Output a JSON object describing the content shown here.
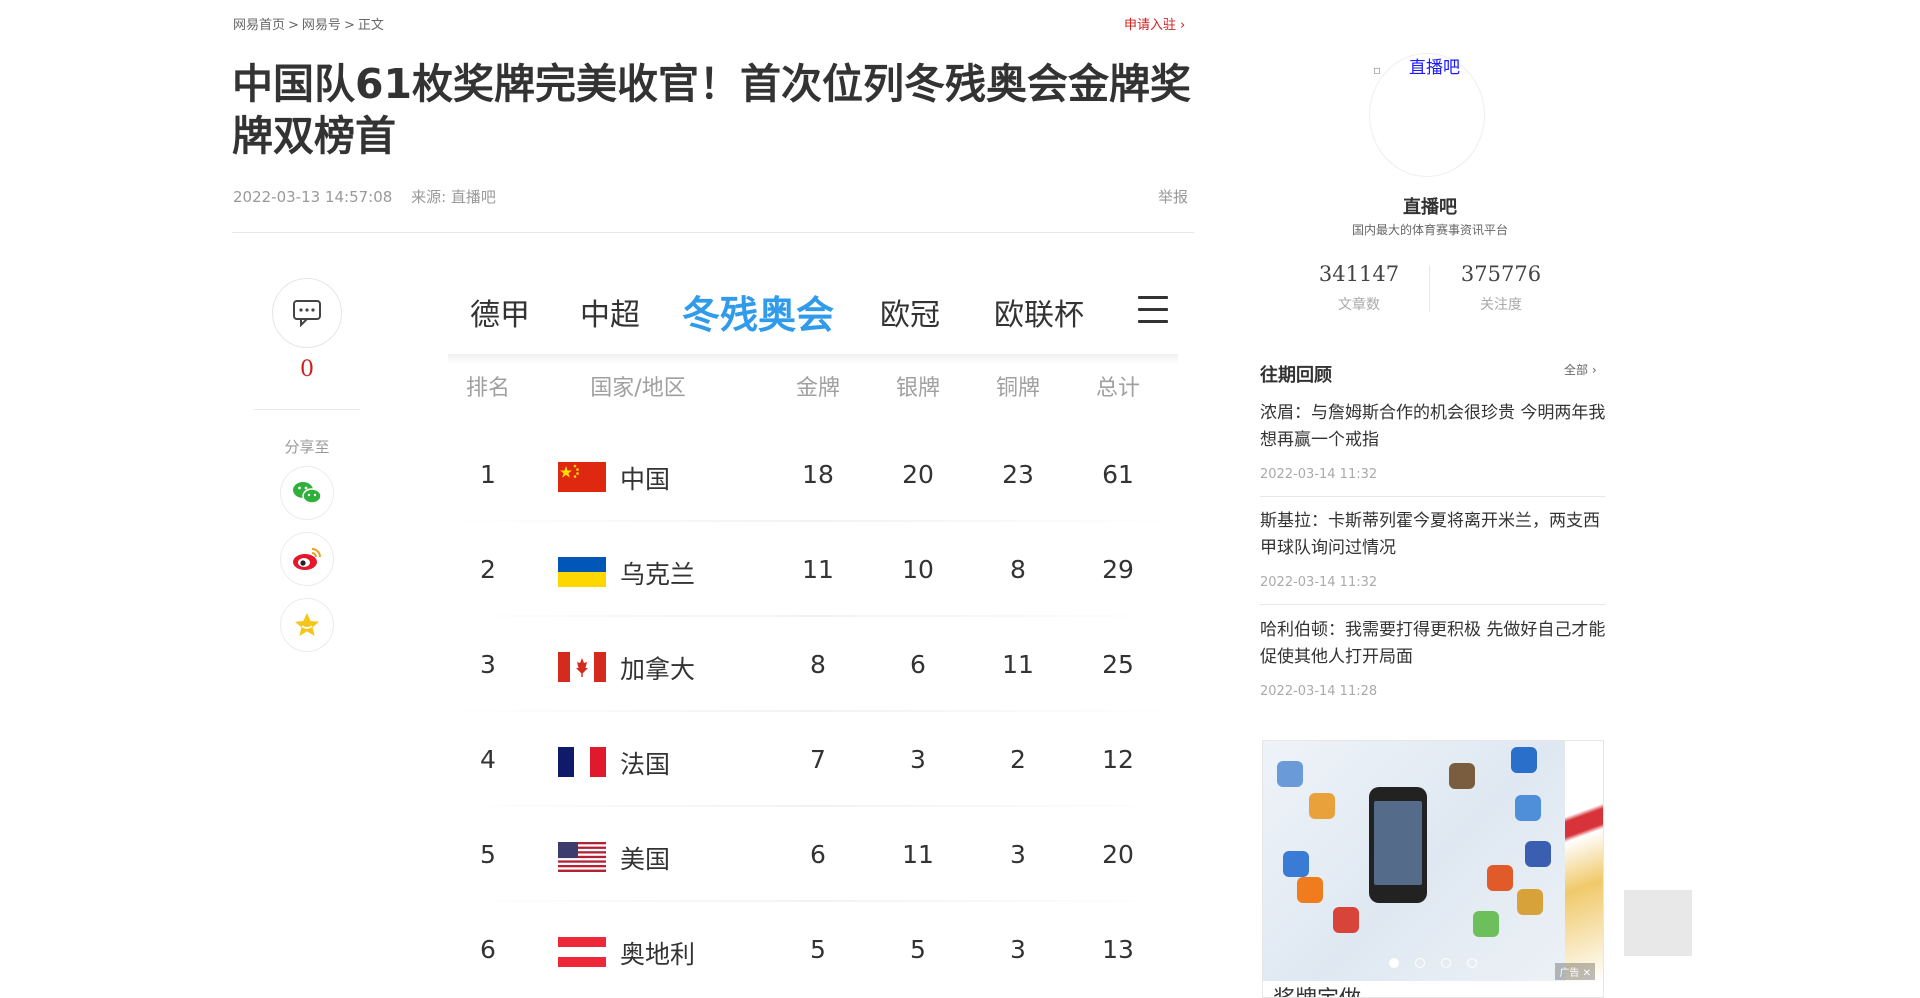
{
  "breadcrumb": {
    "home": "网易首页",
    "section": "网易号",
    "current": "正文",
    "sep": ">"
  },
  "apply": {
    "label": "申请入驻",
    "chev": "›"
  },
  "article": {
    "title": "中国队61枚奖牌完美收官！首次位列冬残奥会金牌奖牌双榜首",
    "datetime": "2022-03-13 14:57:08",
    "source": "来源: 直播吧",
    "report": "举报"
  },
  "social": {
    "comment_count": "0",
    "share_label": "分享至"
  },
  "medal_image": {
    "tabs": [
      "德甲",
      "中超",
      "冬残奥会",
      "欧冠",
      "欧联杯"
    ],
    "active_tab": "冬残奥会",
    "headers": {
      "rank": "排名",
      "country": "国家/地区",
      "gold": "金牌",
      "silver": "银牌",
      "bronze": "铜牌",
      "total": "总计"
    },
    "rows": [
      {
        "rank": "1",
        "country": "中国",
        "gold": "18",
        "silver": "20",
        "bronze": "23",
        "total": "61",
        "flag": "china"
      },
      {
        "rank": "2",
        "country": "乌克兰",
        "gold": "11",
        "silver": "10",
        "bronze": "8",
        "total": "29",
        "flag": "ukraine"
      },
      {
        "rank": "3",
        "country": "加拿大",
        "gold": "8",
        "silver": "6",
        "bronze": "11",
        "total": "25",
        "flag": "canada"
      },
      {
        "rank": "4",
        "country": "法国",
        "gold": "7",
        "silver": "3",
        "bronze": "2",
        "total": "12",
        "flag": "france"
      },
      {
        "rank": "5",
        "country": "美国",
        "gold": "6",
        "silver": "11",
        "bronze": "3",
        "total": "20",
        "flag": "usa"
      },
      {
        "rank": "6",
        "country": "奥地利",
        "gold": "5",
        "silver": "5",
        "bronze": "3",
        "total": "13",
        "flag": "austria"
      }
    ]
  },
  "profile": {
    "avatar_alt": "直播吧",
    "name": "直播吧",
    "desc": "国内最大的体育赛事资讯平台",
    "articles": "341147",
    "articles_label": "文章数",
    "followers": "375776",
    "followers_label": "关注度"
  },
  "reviews": {
    "title": "往期回顾",
    "all": "全部 ›",
    "items": [
      {
        "title": "浓眉：与詹姆斯合作的机会很珍贵 今明两年我想再赢一个戒指",
        "date": "2022-03-14 11:32"
      },
      {
        "title": "斯基拉：卡斯蒂列霍今夏将离开米兰，两支西甲球队询问过情况",
        "date": "2022-03-14 11:32"
      },
      {
        "title": "哈利伯顿：我需要打得更积极 先做好自己才能促使其他人打开局面",
        "date": "2022-03-14 11:28"
      }
    ]
  },
  "ad": {
    "caption": "奖牌定做",
    "tag": "广告 ✕"
  },
  "colors": {
    "accent_red": "#d21e1e",
    "active_tab_blue": "#2f9bea",
    "link_blue": "#1a1aff"
  }
}
